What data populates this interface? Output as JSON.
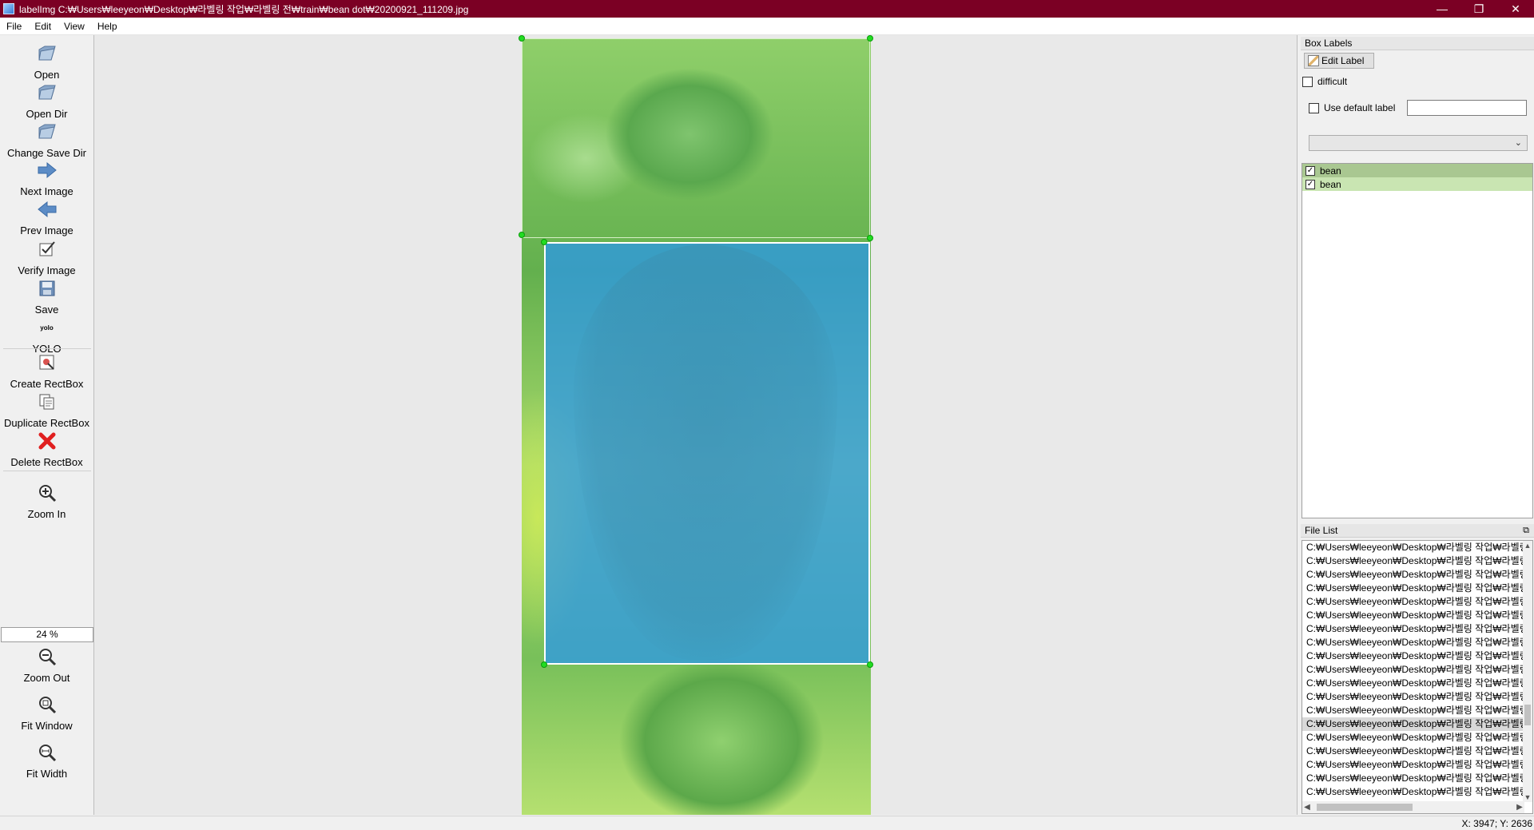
{
  "window": {
    "title": "labelImg C:₩Users₩leeyeon₩Desktop₩라벨링 작업₩라벨링 전₩train₩bean dot₩20200921_111209.jpg",
    "minimize": "—",
    "restore": "❐",
    "close": "✕"
  },
  "menu": [
    "File",
    "Edit",
    "View",
    "Help"
  ],
  "toolbar": {
    "open": "Open",
    "open_dir": "Open Dir",
    "change_save_dir": "Change Save Dir",
    "next_image": "Next Image",
    "prev_image": "Prev Image",
    "verify_image": "Verify Image",
    "save": "Save",
    "format_icon_text": "yolo",
    "format": "YOLO",
    "create_rectbox": "Create RectBox",
    "duplicate_rectbox": "Duplicate RectBox",
    "delete_rectbox": "Delete RectBox",
    "zoom_in": "Zoom In",
    "zoom_value": "24 %",
    "zoom_out": "Zoom Out",
    "fit_window": "Fit Window",
    "fit_width": "Fit Width"
  },
  "box_labels": {
    "title": "Box Labels",
    "edit_label": "Edit Label",
    "difficult": "difficult",
    "use_default_label": "Use default label",
    "default_label_value": "",
    "combo_value": "",
    "labels": [
      {
        "text": "bean",
        "checked": true
      },
      {
        "text": "bean",
        "checked": true
      }
    ]
  },
  "file_list": {
    "title": "File List",
    "items": [
      "C:₩Users₩leeyeon₩Desktop₩라벨링 작업₩라벨링",
      "C:₩Users₩leeyeon₩Desktop₩라벨링 작업₩라벨링",
      "C:₩Users₩leeyeon₩Desktop₩라벨링 작업₩라벨링",
      "C:₩Users₩leeyeon₩Desktop₩라벨링 작업₩라벨링",
      "C:₩Users₩leeyeon₩Desktop₩라벨링 작업₩라벨링",
      "C:₩Users₩leeyeon₩Desktop₩라벨링 작업₩라벨링",
      "C:₩Users₩leeyeon₩Desktop₩라벨링 작업₩라벨링",
      "C:₩Users₩leeyeon₩Desktop₩라벨링 작업₩라벨링",
      "C:₩Users₩leeyeon₩Desktop₩라벨링 작업₩라벨링",
      "C:₩Users₩leeyeon₩Desktop₩라벨링 작업₩라벨링",
      "C:₩Users₩leeyeon₩Desktop₩라벨링 작업₩라벨링",
      "C:₩Users₩leeyeon₩Desktop₩라벨링 작업₩라벨링",
      "C:₩Users₩leeyeon₩Desktop₩라벨링 작업₩라벨링",
      "C:₩Users₩leeyeon₩Desktop₩라벨링 작업₩라벨링",
      "C:₩Users₩leeyeon₩Desktop₩라벨링 작업₩라벨링",
      "C:₩Users₩leeyeon₩Desktop₩라벨링 작업₩라벨링",
      "C:₩Users₩leeyeon₩Desktop₩라벨링 작업₩라벨링",
      "C:₩Users₩leeyeon₩Desktop₩라벨링 작업₩라벨링",
      "C:₩Users₩leeyeon₩Desktop₩라벨링 작업₩라벨링"
    ],
    "current_index": 13
  },
  "status": {
    "coords": "X: 3947; Y: 2636"
  },
  "colors": {
    "titlebar": "#7b0024",
    "bbox_fill": "#2896f0",
    "handle": "#22dd22",
    "label_selected": "#a9c791"
  }
}
